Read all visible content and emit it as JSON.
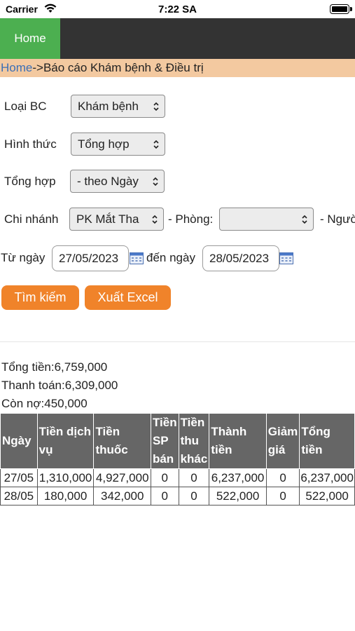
{
  "status_bar": {
    "carrier": "Carrier",
    "time": "7:22 SA"
  },
  "nav": {
    "home_label": "Home"
  },
  "breadcrumb": {
    "home_link": "Home",
    "separator": "->",
    "current": "Báo cáo Khám bệnh & Điều trị"
  },
  "form": {
    "report_type": {
      "label": "Loại BC",
      "value": "Khám bệnh"
    },
    "format": {
      "label": "Hình thức",
      "value": "Tổng hợp"
    },
    "aggregate": {
      "label": "Tổng hợp",
      "value": "- theo Ngày"
    },
    "branch": {
      "label": "Chi nhánh",
      "value": "PK Mắt Tha"
    },
    "room": {
      "label": "- Phòng:",
      "value": ""
    },
    "person": {
      "label": "- Ngườ"
    },
    "from_date": {
      "label": "Từ ngày",
      "value": "27/05/2023"
    },
    "to_date": {
      "label": "đến ngày",
      "value": "28/05/2023"
    }
  },
  "buttons": {
    "search": "Tìm kiếm",
    "export": "Xuất Excel"
  },
  "summary": {
    "total": "Tổng tiền:6,759,000",
    "paid": "Thanh toán:6,309,000",
    "debt": "Còn nợ:450,000"
  },
  "table": {
    "headers": [
      "Ngày",
      "Tiền dịch vụ",
      "Tiền thuốc",
      "Tiền SP bán",
      "Tiền thu khác",
      "Thành tiền",
      "Giảm giá",
      "Tổng tiền"
    ],
    "rows": [
      [
        "27/05",
        "1,310,000",
        "4,927,000",
        "0",
        "0",
        "6,237,000",
        "0",
        "6,237,000"
      ],
      [
        "28/05",
        "180,000",
        "342,000",
        "0",
        "0",
        "522,000",
        "0",
        "522,000"
      ]
    ]
  },
  "colors": {
    "nav_bg": "#333333",
    "home_active": "#4caf50",
    "breadcrumb_bg": "#f3c9a0",
    "button": "#f0832a",
    "table_header": "#666666"
  },
  "icons": {
    "wifi": "wifi-icon",
    "battery": "battery-icon",
    "select_arrow": "updown-chevron-icon",
    "calendar": "calendar-icon"
  }
}
